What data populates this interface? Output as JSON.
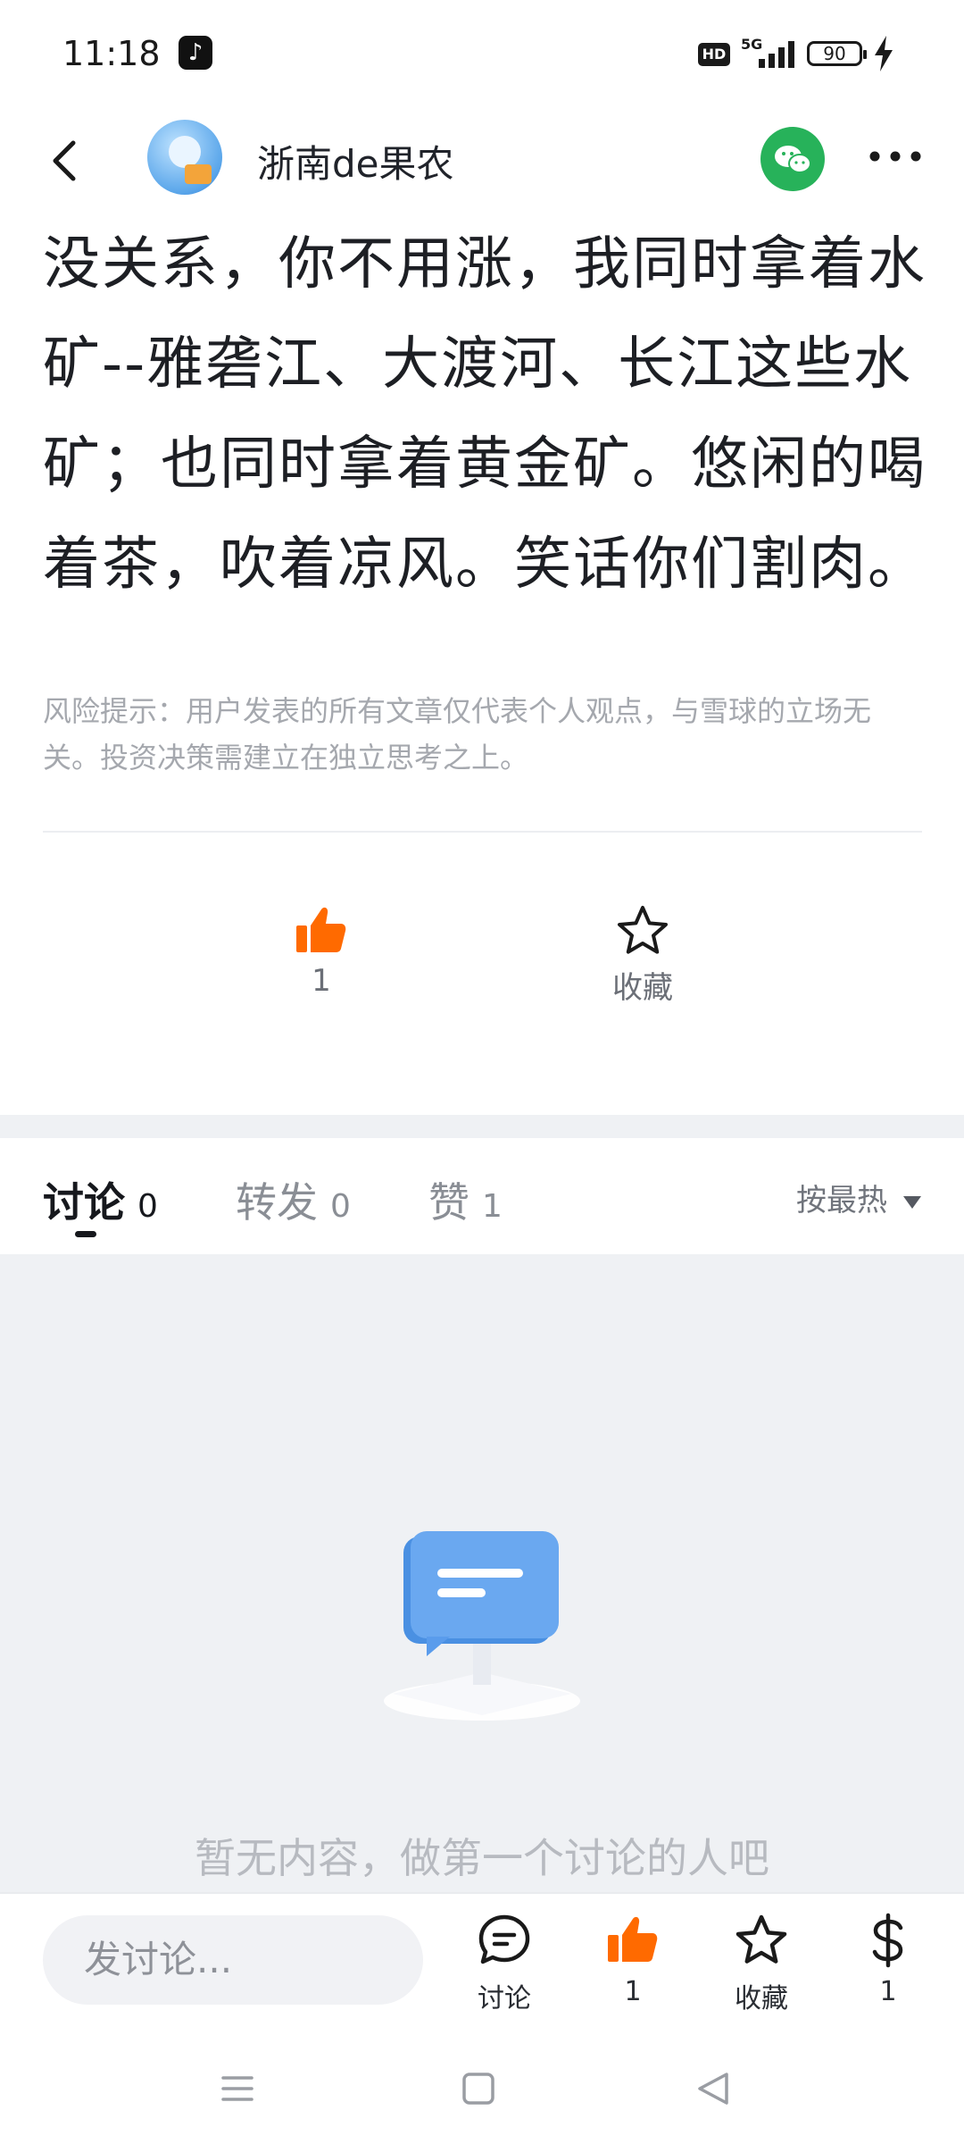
{
  "status_bar": {
    "time": "11:18",
    "network": "5G",
    "hd": "HD",
    "battery": "90"
  },
  "header": {
    "username": "浙南de果农",
    "icons": [
      "back-icon",
      "avatar",
      "wechat-icon",
      "more-icon"
    ]
  },
  "article": {
    "text": "没关系，你不用涨，我同时拿着水矿--雅砻江、大渡河、长江这些水矿；也同时拿着黄金矿。悠闲的喝着茶，吹着凉风。笑话你们割肉。"
  },
  "risk_notice": "风险提示：用户发表的所有文章仅代表个人观点，与雪球的立场无关。投资决策需建立在独立思考之上。",
  "actions": {
    "like_count": "1",
    "favorite_label": "收藏"
  },
  "tabs": [
    {
      "label": "讨论",
      "count": "0",
      "active": true
    },
    {
      "label": "转发",
      "count": "0",
      "active": false
    },
    {
      "label": "赞",
      "count": "1",
      "active": false
    }
  ],
  "sort": {
    "label": "按最热"
  },
  "empty_state": {
    "message": "暂无内容，做第一个讨论的人吧"
  },
  "bottom_bar": {
    "input_placeholder": "发讨论...",
    "discuss_label": "讨论",
    "like_count": "1",
    "favorite_label": "收藏",
    "reward_count": "1"
  },
  "colors": {
    "accent_orange": "#ff6a00",
    "wechat_green": "#27b25a",
    "text_primary": "#1d1f24",
    "empty_bg": "#eff1f4"
  }
}
